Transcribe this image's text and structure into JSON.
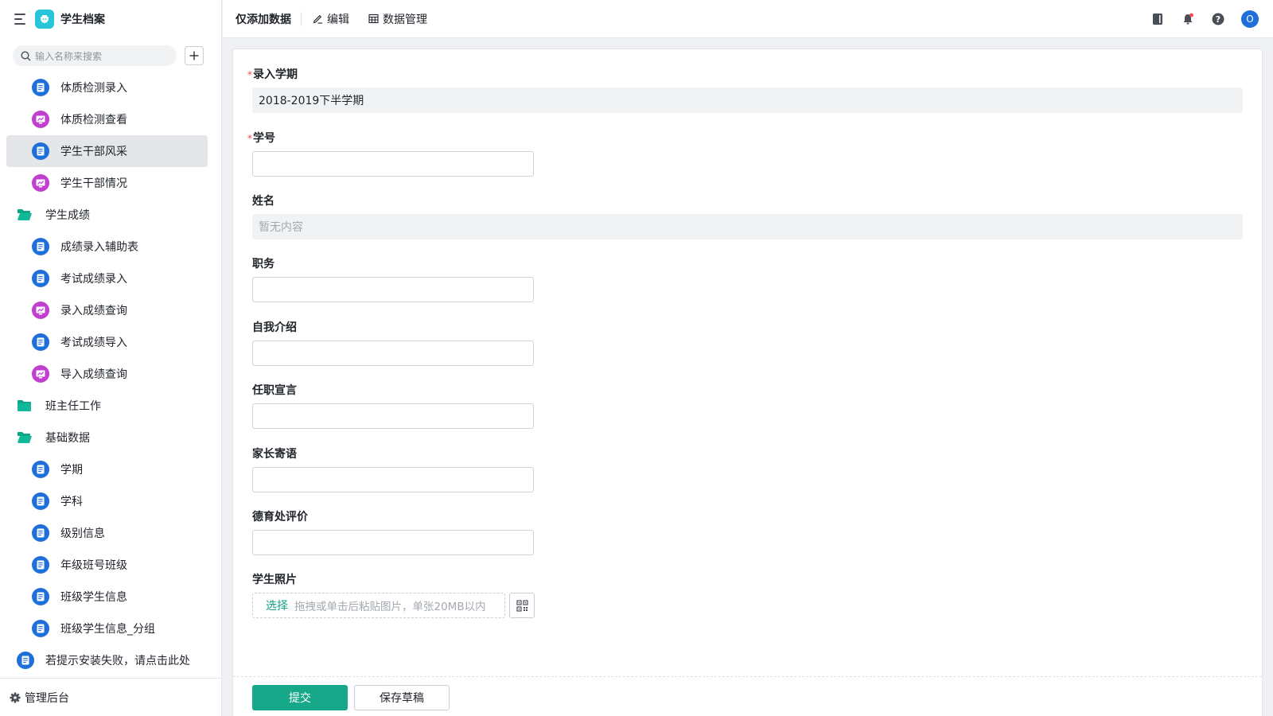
{
  "app": {
    "title": "学生档案",
    "accent": "#17a889"
  },
  "sidebar": {
    "search_placeholder": "输入名称来搜索",
    "items": [
      {
        "label": "体质检测录入",
        "icon": "form-icon",
        "kind": "child"
      },
      {
        "label": "体质检测查看",
        "icon": "report-icon",
        "kind": "child"
      },
      {
        "label": "学生干部风采",
        "icon": "form-icon",
        "kind": "child",
        "active": true
      },
      {
        "label": "学生干部情况",
        "icon": "report-icon",
        "kind": "child"
      },
      {
        "label": "学生成绩",
        "icon": "folder-open-icon",
        "kind": "folder"
      },
      {
        "label": "成绩录入辅助表",
        "icon": "form-icon",
        "kind": "child"
      },
      {
        "label": "考试成绩录入",
        "icon": "form-icon",
        "kind": "child"
      },
      {
        "label": "录入成绩查询",
        "icon": "report-icon",
        "kind": "child"
      },
      {
        "label": "考试成绩导入",
        "icon": "form-icon",
        "kind": "child"
      },
      {
        "label": "导入成绩查询",
        "icon": "report-icon",
        "kind": "child"
      },
      {
        "label": "班主任工作",
        "icon": "folder-icon",
        "kind": "folder"
      },
      {
        "label": "基础数据",
        "icon": "folder-open-icon",
        "kind": "folder"
      },
      {
        "label": "学期",
        "icon": "form-icon",
        "kind": "child"
      },
      {
        "label": "学科",
        "icon": "form-icon",
        "kind": "child"
      },
      {
        "label": "级别信息",
        "icon": "form-icon",
        "kind": "child"
      },
      {
        "label": "年级班号班级",
        "icon": "form-icon",
        "kind": "child"
      },
      {
        "label": "班级学生信息",
        "icon": "form-icon",
        "kind": "child"
      },
      {
        "label": "班级学生信息_分组",
        "icon": "form-icon",
        "kind": "child"
      },
      {
        "label": "若提示安装失败，请点击此处",
        "icon": "form-icon",
        "kind": "root"
      }
    ],
    "admin_label": "管理后台"
  },
  "topbar": {
    "title": "仅添加数据",
    "edit_label": "编辑",
    "data_manage_label": "数据管理"
  },
  "form": {
    "term": {
      "label": "录入学期",
      "required": true,
      "value": "2018-2019下半学期"
    },
    "student_id": {
      "label": "学号",
      "required": true,
      "value": ""
    },
    "name": {
      "label": "姓名",
      "value": "暂无内容"
    },
    "position": {
      "label": "职务",
      "value": ""
    },
    "intro": {
      "label": "自我介绍",
      "value": ""
    },
    "declaration": {
      "label": "任职宣言",
      "value": ""
    },
    "parent_message": {
      "label": "家长寄语",
      "value": ""
    },
    "moral_review": {
      "label": "德育处评价",
      "value": ""
    },
    "photo": {
      "label": "学生照片",
      "select_label": "选择",
      "hint": "拖拽或单击后粘贴图片，单张20MB以内"
    },
    "submit_label": "提交",
    "draft_label": "保存草稿"
  },
  "user": {
    "avatar_initial": "O"
  }
}
